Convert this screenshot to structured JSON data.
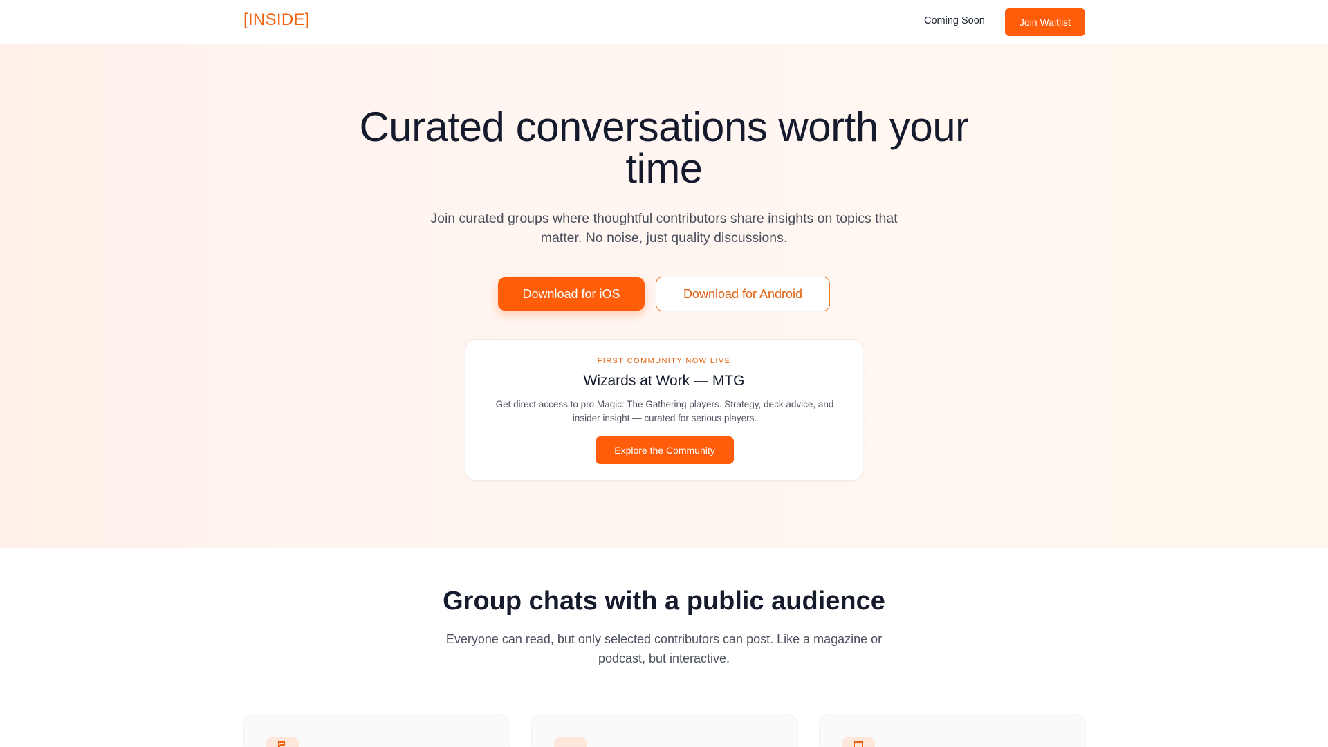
{
  "nav": {
    "logo": "[INSIDE]",
    "coming_soon": "Coming Soon",
    "join_waitlist": "Join Waitlist"
  },
  "hero": {
    "title": "Curated conversations worth your time",
    "subtitle": "Join curated groups where thoughtful contributors share insights on topics that matter. No noise, just quality discussions.",
    "ios_button": "Download for iOS",
    "android_button": "Download for Android"
  },
  "community_card": {
    "eyebrow": "FIRST COMMUNITY NOW LIVE",
    "title": "Wizards at Work — MTG",
    "description": "Get direct access to pro Magic: The Gathering players. Strategy, deck advice, and insider insight — curated for serious players.",
    "button": "Explore the Community"
  },
  "features_section": {
    "title": "Group chats with a public audience",
    "subtitle": "Everyone can read, but only selected contributors can post. Like a magazine or podcast, but interactive.",
    "cards": [
      {
        "icon": "chat-icon"
      },
      {
        "icon": "people-icon"
      },
      {
        "icon": "document-icon"
      }
    ]
  },
  "colors": {
    "accent": "#ff5d0a",
    "accent_text": "#e2600e",
    "heading": "#151a2c",
    "body_text": "#4a4f5c"
  }
}
